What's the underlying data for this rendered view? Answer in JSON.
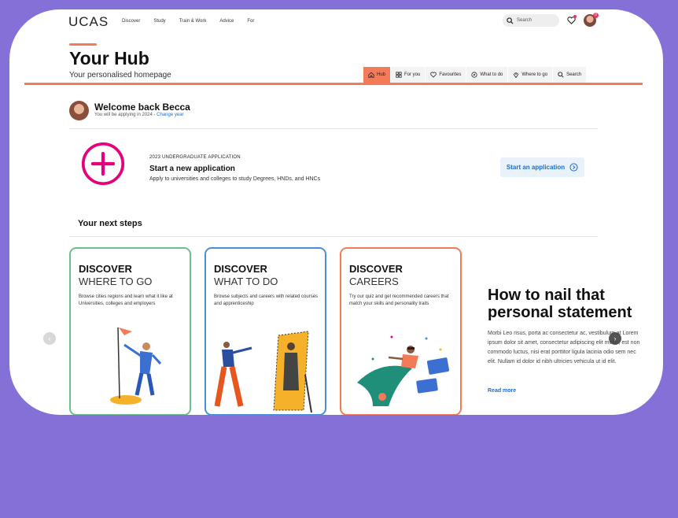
{
  "brand": {
    "logo": "UCAS",
    "accent": "#f37b5a",
    "link": "#1a6fd1",
    "background": "#8570d8"
  },
  "nav": {
    "links": [
      "Discover",
      "Study",
      "Train & Work",
      "Advice",
      "For"
    ],
    "search_placeholder": "Search",
    "notification_count": "0"
  },
  "hub": {
    "title": "Your Hub",
    "subtitle": "Your personalised homepage",
    "tabs": [
      {
        "label": "Hub",
        "icon": "home-icon",
        "active": true
      },
      {
        "label": "For you",
        "icon": "grid-icon"
      },
      {
        "label": "Favourites",
        "icon": "heart-icon"
      },
      {
        "label": "What to do",
        "icon": "compass-icon"
      },
      {
        "label": "Where to go",
        "icon": "pin-icon"
      },
      {
        "label": "Search",
        "icon": "search-icon"
      }
    ]
  },
  "welcome": {
    "greeting": "Welcome back Becca",
    "applying_text": "You will be applying in 2024 -",
    "change_year": "Change year"
  },
  "application": {
    "label": "2023 UNDERGRADUATE APPLICATION",
    "title": "Start a new application",
    "description": "Apply to universities and colleges to study Degrees, HNDs, and HNCs",
    "button": "Start an application"
  },
  "next_steps": {
    "title": "Your next steps",
    "cards": [
      {
        "head": "DISCOVER",
        "sub": "WHERE TO GO",
        "desc": "Browse cities regions and learn what it like at Universities, colleges and employers",
        "color": "#6cc08a"
      },
      {
        "head": "DISCOVER",
        "sub": "WHAT TO DO",
        "desc": "Browse subjects and careers with related courses and apprenticeship",
        "color": "#4a90d9"
      },
      {
        "head": "DISCOVER",
        "sub": "CAREERS",
        "desc": "Try our quiz and get recommended careers that match your skills and personality traits",
        "color": "#f37b5a"
      }
    ],
    "article": {
      "title": "How to nail that personal statement",
      "body": "Morbi Leo risus, porta ac consectetur ac, vestibulum at Lorem ipsum dolor sit amet, consectetur adipiscing elit mollis, est non commodo luctus, nisi erat porttitor ligula lacinia odio sem nec elit. Nullam id dolor id nibh ultricies vehicula ut id elit.",
      "read_more": "Read more"
    }
  }
}
